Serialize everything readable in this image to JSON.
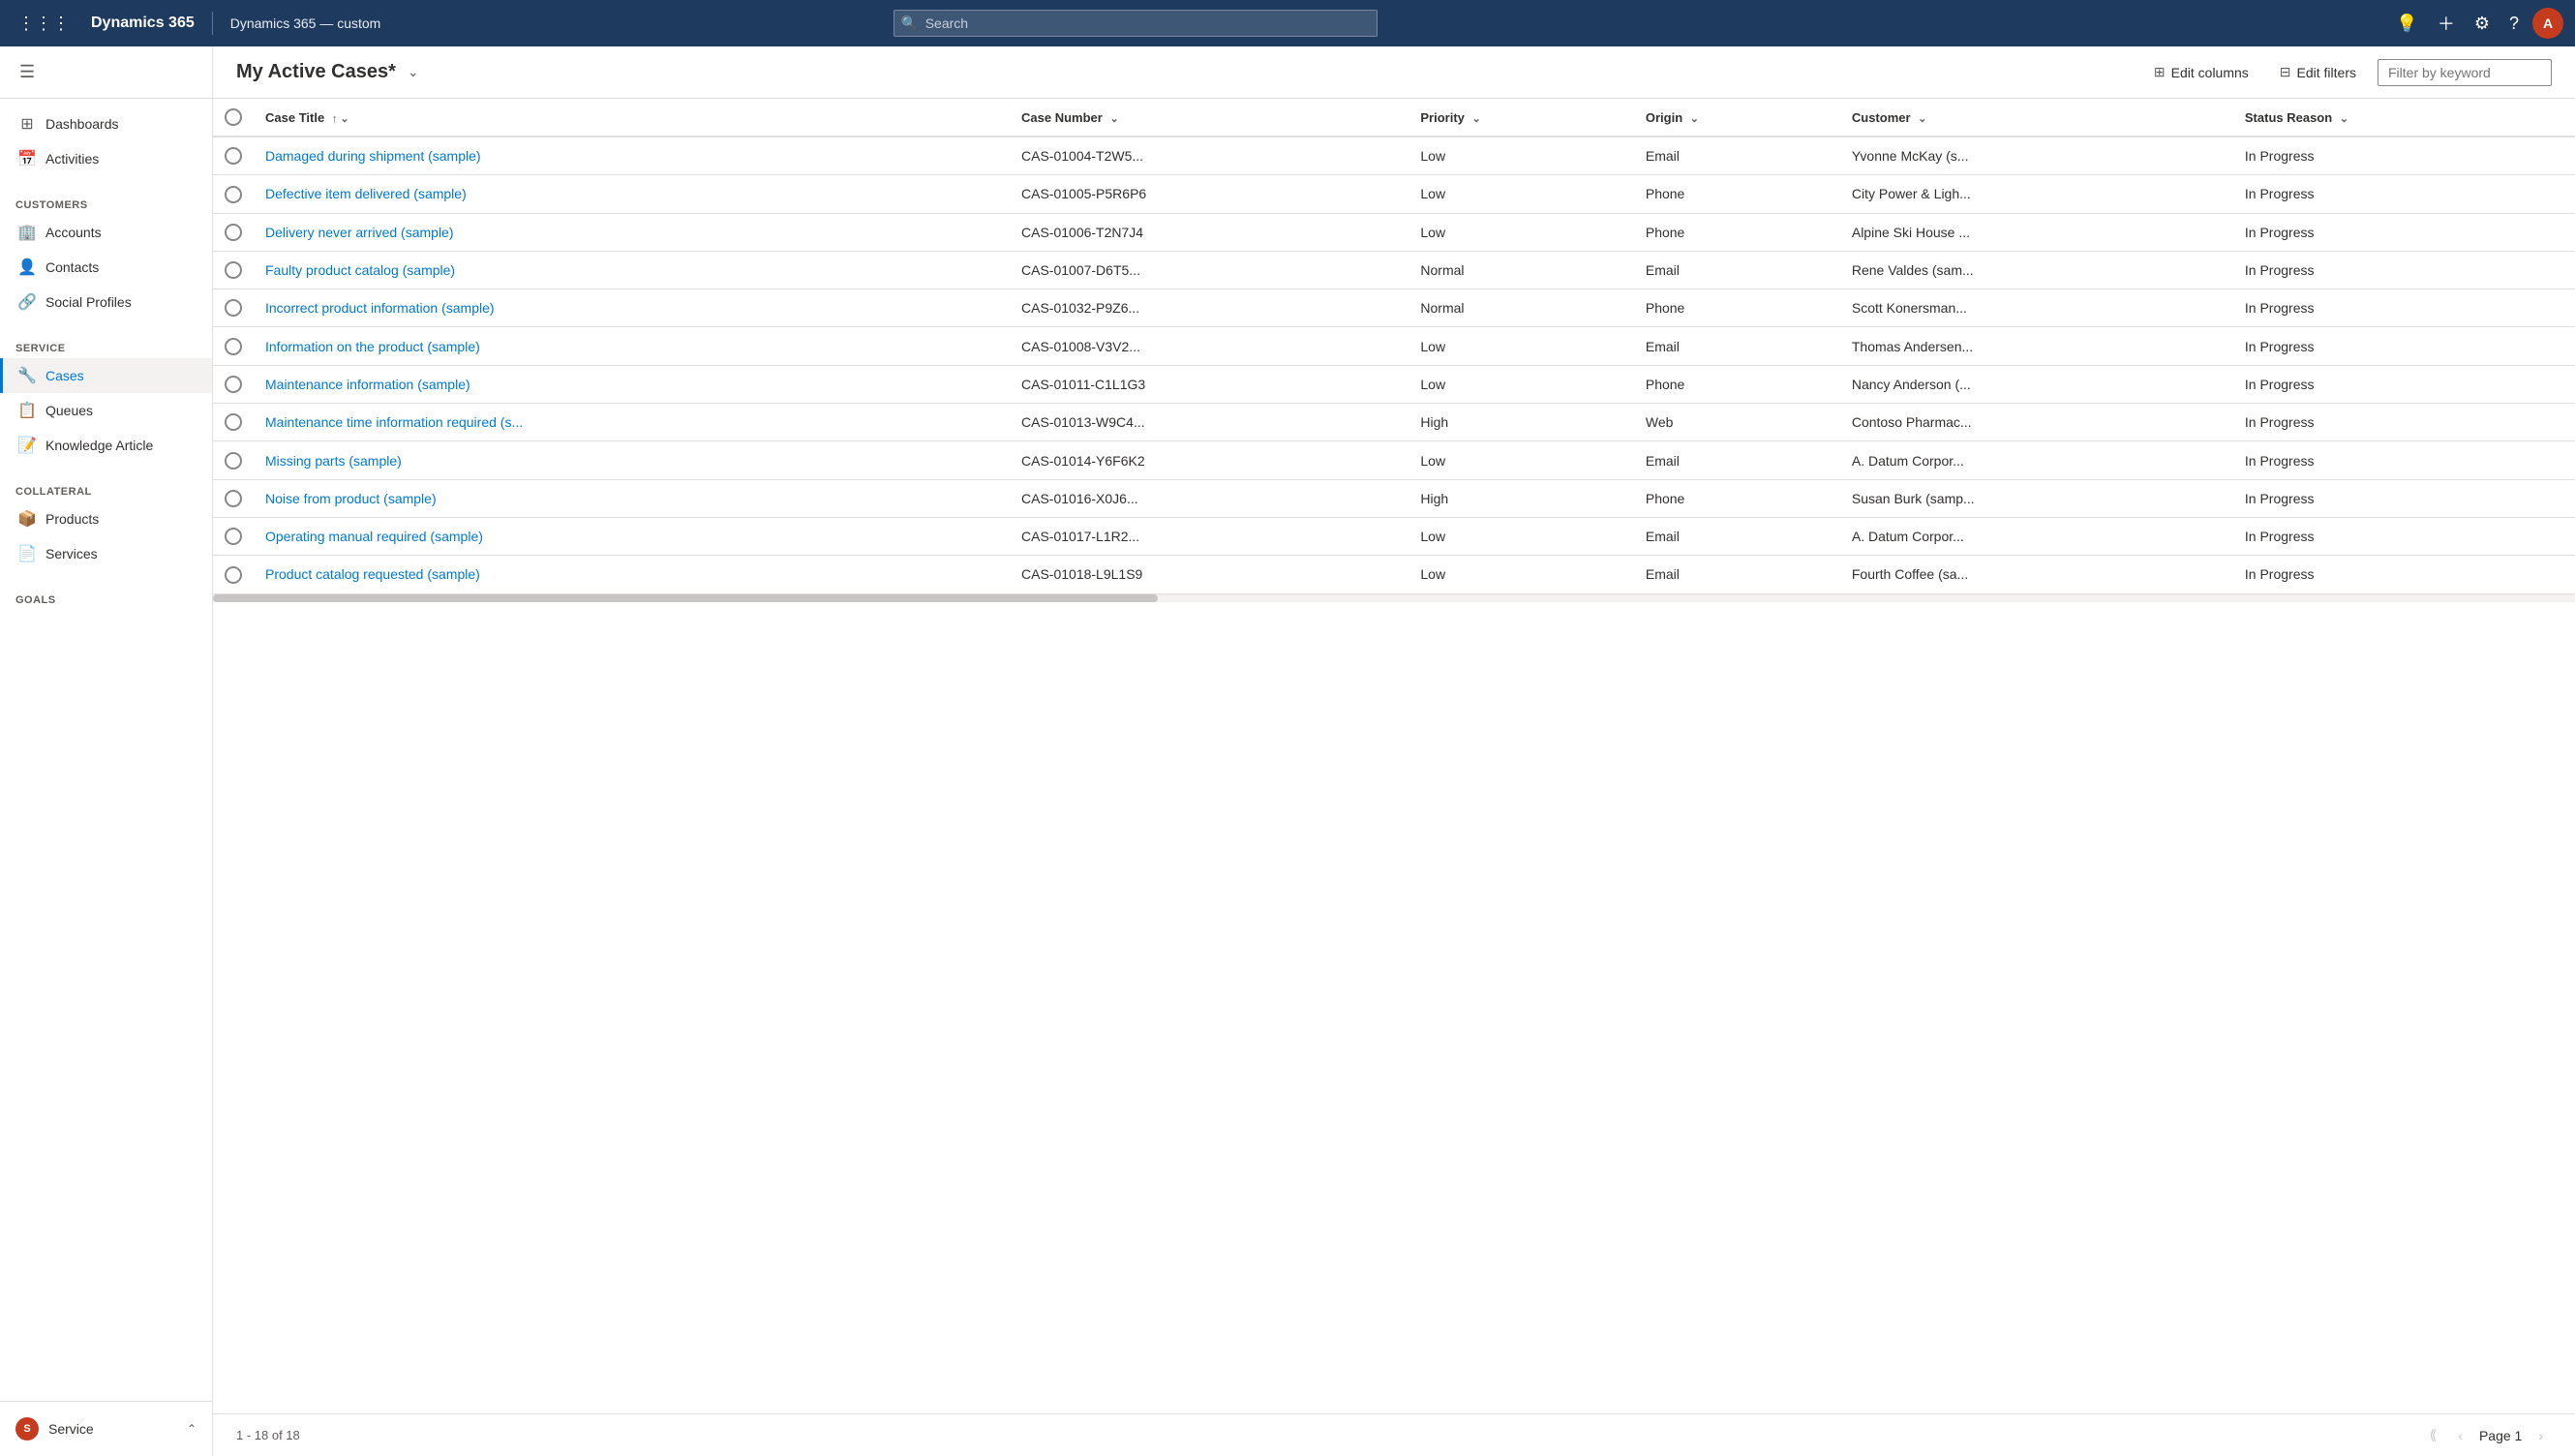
{
  "topNav": {
    "brand": "Dynamics 365",
    "appName": "Dynamics 365 — custom",
    "searchPlaceholder": "Search",
    "avatarInitial": "A"
  },
  "sidebar": {
    "menuIcon": "≡",
    "standaloneItems": [
      {
        "id": "dashboards",
        "label": "Dashboards",
        "icon": "⊞"
      },
      {
        "id": "activities",
        "label": "Activities",
        "icon": "📅"
      }
    ],
    "sections": [
      {
        "label": "Customers",
        "items": [
          {
            "id": "accounts",
            "label": "Accounts",
            "icon": "🏢"
          },
          {
            "id": "contacts",
            "label": "Contacts",
            "icon": "👤"
          },
          {
            "id": "social-profiles",
            "label": "Social Profiles",
            "icon": "🔗"
          }
        ]
      },
      {
        "label": "Service",
        "items": [
          {
            "id": "cases",
            "label": "Cases",
            "icon": "🔧",
            "active": true
          },
          {
            "id": "queues",
            "label": "Queues",
            "icon": "📋"
          },
          {
            "id": "knowledge-article",
            "label": "Knowledge Article",
            "icon": "📝"
          }
        ]
      },
      {
        "label": "Collateral",
        "items": [
          {
            "id": "products",
            "label": "Products",
            "icon": "📦"
          },
          {
            "id": "services",
            "label": "Services",
            "icon": "📄"
          }
        ]
      },
      {
        "label": "Goals",
        "items": []
      }
    ],
    "bottomItem": {
      "initial": "S",
      "label": "Service",
      "chevron": "⌃"
    }
  },
  "content": {
    "title": "My Active Cases*",
    "editColumnsLabel": "Edit columns",
    "editFiltersLabel": "Edit filters",
    "filterPlaceholder": "Filter by keyword",
    "tableColumns": [
      {
        "id": "case-title",
        "label": "Case Title",
        "sortable": true,
        "sortDir": "asc"
      },
      {
        "id": "case-number",
        "label": "Case Number",
        "sortable": true
      },
      {
        "id": "priority",
        "label": "Priority",
        "sortable": true
      },
      {
        "id": "origin",
        "label": "Origin",
        "sortable": true
      },
      {
        "id": "customer",
        "label": "Customer",
        "sortable": true
      },
      {
        "id": "status-reason",
        "label": "Status Reason",
        "sortable": true
      }
    ],
    "rows": [
      {
        "caseTitle": "Damaged during shipment (sample)",
        "caseNumber": "CAS-01004-T2W5...",
        "priority": "Low",
        "origin": "Email",
        "customer": "Yvonne McKay (s...",
        "statusReason": "In Progress"
      },
      {
        "caseTitle": "Defective item delivered (sample)",
        "caseNumber": "CAS-01005-P5R6P6",
        "priority": "Low",
        "origin": "Phone",
        "customer": "City Power & Ligh...",
        "statusReason": "In Progress"
      },
      {
        "caseTitle": "Delivery never arrived (sample)",
        "caseNumber": "CAS-01006-T2N7J4",
        "priority": "Low",
        "origin": "Phone",
        "customer": "Alpine Ski House ...",
        "statusReason": "In Progress"
      },
      {
        "caseTitle": "Faulty product catalog (sample)",
        "caseNumber": "CAS-01007-D6T5...",
        "priority": "Normal",
        "origin": "Email",
        "customer": "Rene Valdes (sam...",
        "statusReason": "In Progress"
      },
      {
        "caseTitle": "Incorrect product information (sample)",
        "caseNumber": "CAS-01032-P9Z6...",
        "priority": "Normal",
        "origin": "Phone",
        "customer": "Scott Konersman...",
        "statusReason": "In Progress"
      },
      {
        "caseTitle": "Information on the product (sample)",
        "caseNumber": "CAS-01008-V3V2...",
        "priority": "Low",
        "origin": "Email",
        "customer": "Thomas Andersen...",
        "statusReason": "In Progress"
      },
      {
        "caseTitle": "Maintenance information (sample)",
        "caseNumber": "CAS-01011-C1L1G3",
        "priority": "Low",
        "origin": "Phone",
        "customer": "Nancy Anderson (...",
        "statusReason": "In Progress"
      },
      {
        "caseTitle": "Maintenance time information required (s...",
        "caseNumber": "CAS-01013-W9C4...",
        "priority": "High",
        "origin": "Web",
        "customer": "Contoso Pharmac...",
        "statusReason": "In Progress"
      },
      {
        "caseTitle": "Missing parts (sample)",
        "caseNumber": "CAS-01014-Y6F6K2",
        "priority": "Low",
        "origin": "Email",
        "customer": "A. Datum Corpor...",
        "statusReason": "In Progress"
      },
      {
        "caseTitle": "Noise from product (sample)",
        "caseNumber": "CAS-01016-X0J6...",
        "priority": "High",
        "origin": "Phone",
        "customer": "Susan Burk (samp...",
        "statusReason": "In Progress"
      },
      {
        "caseTitle": "Operating manual required (sample)",
        "caseNumber": "CAS-01017-L1R2...",
        "priority": "Low",
        "origin": "Email",
        "customer": "A. Datum Corpor...",
        "statusReason": "In Progress"
      },
      {
        "caseTitle": "Product catalog requested (sample)",
        "caseNumber": "CAS-01018-L9L1S9",
        "priority": "Low",
        "origin": "Email",
        "customer": "Fourth Coffee (sa...",
        "statusReason": "In Progress"
      }
    ],
    "pagination": {
      "info": "1 - 18 of 18",
      "pageLabel": "Page 1"
    }
  }
}
